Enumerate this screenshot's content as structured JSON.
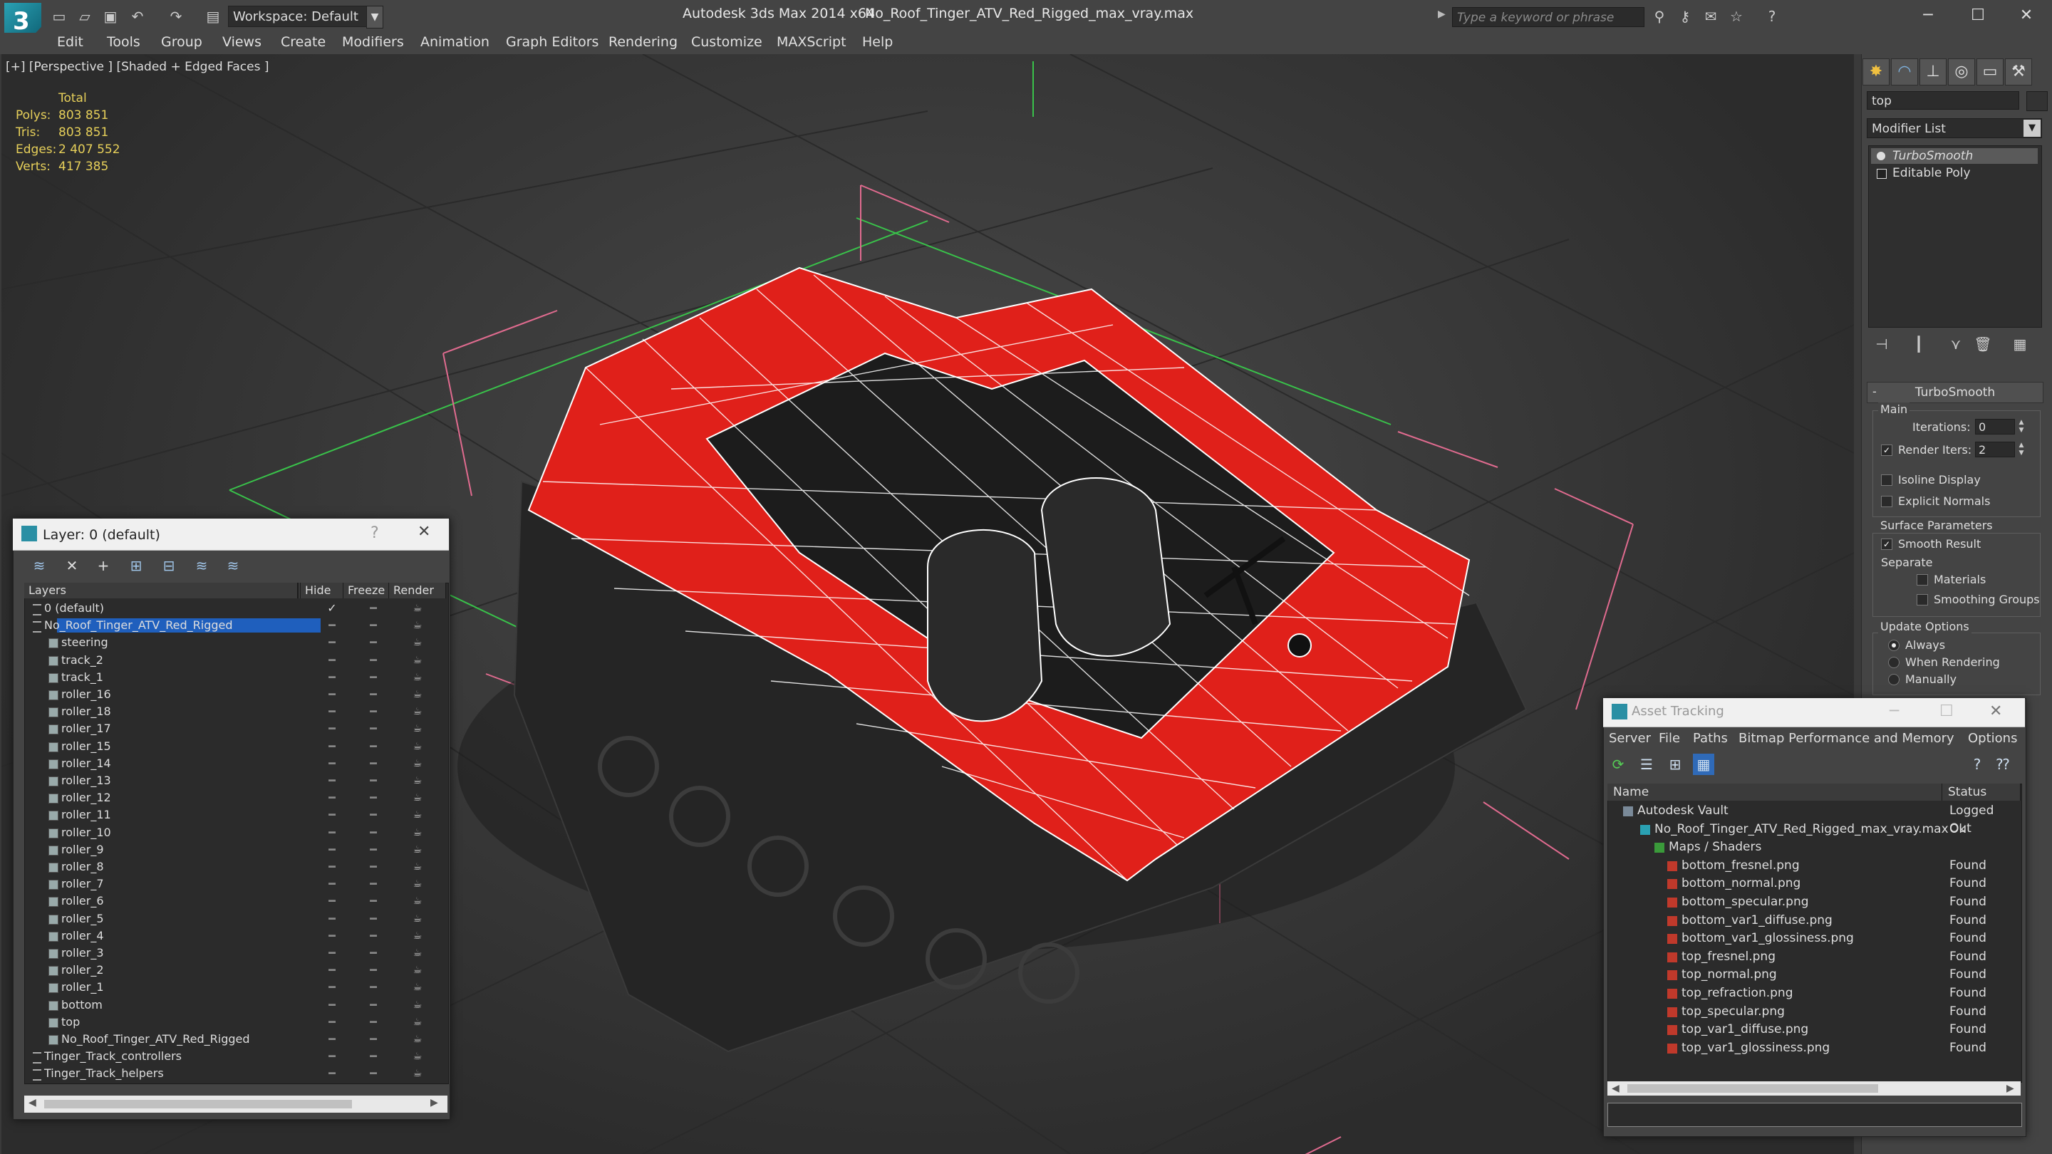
{
  "titlebar": {
    "app_title": "Autodesk 3ds Max  2014 x64",
    "file_title": "No_Roof_Tinger_ATV_Red_Rigged_max_vray.max",
    "workspace": "Workspace: Default",
    "search_placeholder": "Type a keyword or phrase"
  },
  "menu": [
    "Edit",
    "Tools",
    "Group",
    "Views",
    "Create",
    "Modifiers",
    "Animation",
    "Graph Editors",
    "Rendering",
    "Customize",
    "MAXScript",
    "Help"
  ],
  "viewport": {
    "label": "[+] [Perspective ] [Shaded + Edged Faces ]",
    "stats": {
      "total_label": "Total",
      "rows": [
        {
          "label": "Polys:",
          "value": "803 851"
        },
        {
          "label": "Tris:",
          "value": "803 851"
        },
        {
          "label": "Edges:",
          "value": "2 407 552"
        },
        {
          "label": "Verts:",
          "value": "417 385"
        }
      ]
    },
    "colors": {
      "body_red": "#e0201a",
      "wire": "#ffffff",
      "dark_body": "#222222",
      "gizmo_pink": "#e06b8f",
      "grid_green": "#39c24a"
    }
  },
  "command_panel": {
    "object_name": "top",
    "modifier_list": "Modifier List",
    "stack": [
      "TurboSmooth",
      "Editable Poly"
    ],
    "rollout_title": "TurboSmooth",
    "main_group": "Main",
    "iterations_label": "Iterations:",
    "iterations_value": "0",
    "render_iters_label": "Render Iters:",
    "render_iters_value": "2",
    "render_iters_checked": true,
    "isoline_label": "Isoline Display",
    "explicit_label": "Explicit Normals",
    "surface_group": "Surface Parameters",
    "smooth_result_label": "Smooth Result",
    "separate_label": "Separate",
    "materials_label": "Materials",
    "smoothing_groups_label": "Smoothing Groups",
    "update_group": "Update Options",
    "update_options": [
      "Always",
      "When Rendering",
      "Manually"
    ],
    "update_selected": "Always"
  },
  "layer_dialog": {
    "title": "Layer: 0 (default)",
    "help": "?",
    "columns": [
      "Layers",
      "Hide",
      "Freeze",
      "Render"
    ],
    "rows": [
      {
        "name": "0 (default)",
        "level": 0,
        "type": "layer",
        "current": true
      },
      {
        "name": "No_Roof_Tinger_ATV_Red_Rigged",
        "level": 0,
        "type": "layer",
        "selected": true,
        "expanded": true
      },
      {
        "name": "steering",
        "level": 1,
        "type": "object"
      },
      {
        "name": "track_2",
        "level": 1,
        "type": "object"
      },
      {
        "name": "track_1",
        "level": 1,
        "type": "object"
      },
      {
        "name": "roller_16",
        "level": 1,
        "type": "object"
      },
      {
        "name": "roller_18",
        "level": 1,
        "type": "object"
      },
      {
        "name": "roller_17",
        "level": 1,
        "type": "object"
      },
      {
        "name": "roller_15",
        "level": 1,
        "type": "object"
      },
      {
        "name": "roller_14",
        "level": 1,
        "type": "object"
      },
      {
        "name": "roller_13",
        "level": 1,
        "type": "object"
      },
      {
        "name": "roller_12",
        "level": 1,
        "type": "object"
      },
      {
        "name": "roller_11",
        "level": 1,
        "type": "object"
      },
      {
        "name": "roller_10",
        "level": 1,
        "type": "object"
      },
      {
        "name": "roller_9",
        "level": 1,
        "type": "object"
      },
      {
        "name": "roller_8",
        "level": 1,
        "type": "object"
      },
      {
        "name": "roller_7",
        "level": 1,
        "type": "object"
      },
      {
        "name": "roller_6",
        "level": 1,
        "type": "object"
      },
      {
        "name": "roller_5",
        "level": 1,
        "type": "object"
      },
      {
        "name": "roller_4",
        "level": 1,
        "type": "object"
      },
      {
        "name": "roller_3",
        "level": 1,
        "type": "object"
      },
      {
        "name": "roller_2",
        "level": 1,
        "type": "object"
      },
      {
        "name": "roller_1",
        "level": 1,
        "type": "object"
      },
      {
        "name": "bottom",
        "level": 1,
        "type": "object"
      },
      {
        "name": "top",
        "level": 1,
        "type": "object"
      },
      {
        "name": "No_Roof_Tinger_ATV_Red_Rigged",
        "level": 1,
        "type": "object"
      },
      {
        "name": "Tinger_Track_controllers",
        "level": 0,
        "type": "layer"
      },
      {
        "name": "Tinger_Track_helpers",
        "level": 0,
        "type": "layer"
      }
    ]
  },
  "asset_tracking": {
    "title": "Asset Tracking",
    "menu": [
      "Server",
      "File",
      "Paths",
      "Bitmap Performance and Memory",
      "Options"
    ],
    "columns": [
      "Name",
      "Status"
    ],
    "rows": [
      {
        "name": "Autodesk Vault",
        "status": "Logged Out",
        "level": 0,
        "icon": "vault"
      },
      {
        "name": "No_Roof_Tinger_ATV_Red_Rigged_max_vray.max",
        "status": "Ok",
        "level": 1,
        "icon": "max"
      },
      {
        "name": "Maps / Shaders",
        "status": "",
        "level": 2,
        "icon": "maps"
      },
      {
        "name": "bottom_fresnel.png",
        "status": "Found",
        "level": 3,
        "icon": "png"
      },
      {
        "name": "bottom_normal.png",
        "status": "Found",
        "level": 3,
        "icon": "png"
      },
      {
        "name": "bottom_specular.png",
        "status": "Found",
        "level": 3,
        "icon": "png"
      },
      {
        "name": "bottom_var1_diffuse.png",
        "status": "Found",
        "level": 3,
        "icon": "png"
      },
      {
        "name": "bottom_var1_glossiness.png",
        "status": "Found",
        "level": 3,
        "icon": "png"
      },
      {
        "name": "top_fresnel.png",
        "status": "Found",
        "level": 3,
        "icon": "png"
      },
      {
        "name": "top_normal.png",
        "status": "Found",
        "level": 3,
        "icon": "png"
      },
      {
        "name": "top_refraction.png",
        "status": "Found",
        "level": 3,
        "icon": "png"
      },
      {
        "name": "top_specular.png",
        "status": "Found",
        "level": 3,
        "icon": "png"
      },
      {
        "name": "top_var1_diffuse.png",
        "status": "Found",
        "level": 3,
        "icon": "png"
      },
      {
        "name": "top_var1_glossiness.png",
        "status": "Found",
        "level": 3,
        "icon": "png"
      }
    ]
  }
}
